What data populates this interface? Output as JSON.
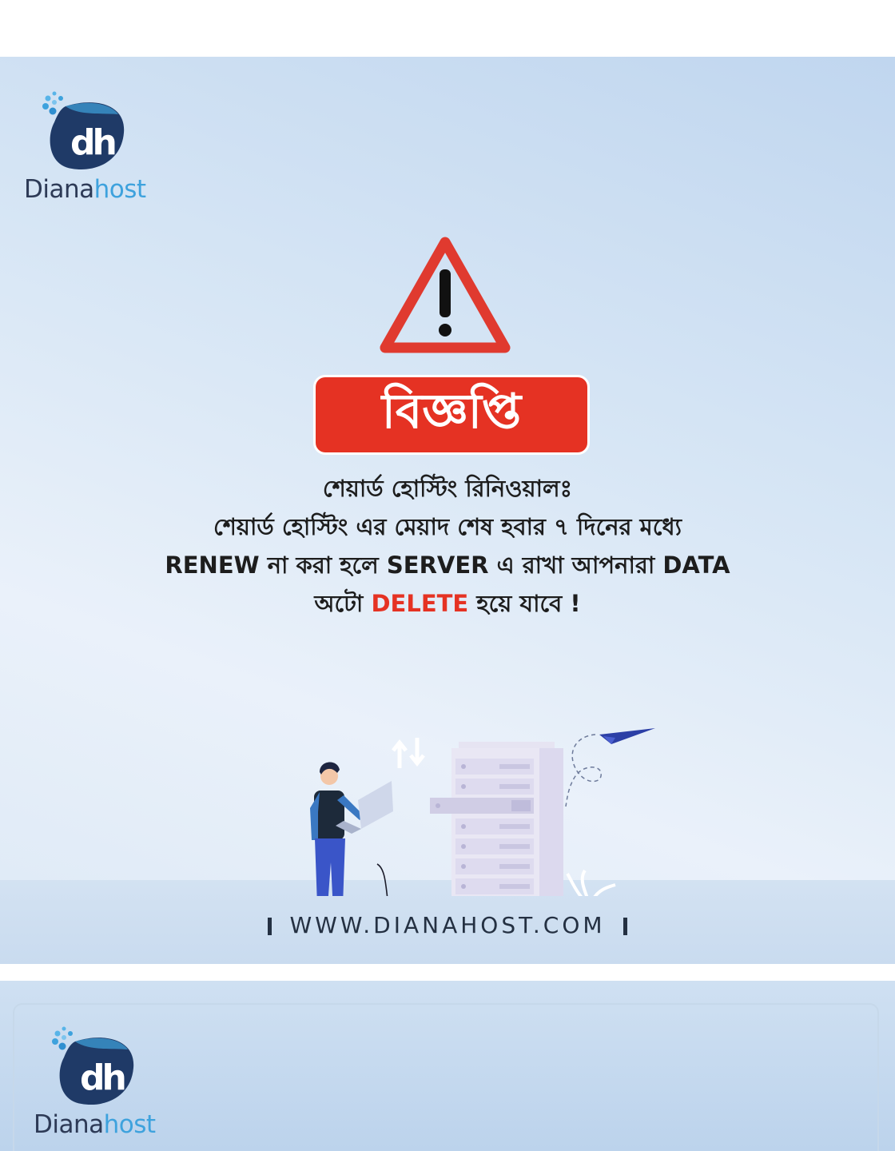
{
  "brand": {
    "name_part1": "Diana",
    "name_part2": "host",
    "logo_glyph": "dh",
    "colors": {
      "dark": "#2d3a56",
      "accent": "#3ea2dd",
      "alert_red": "#e53223"
    }
  },
  "notice": {
    "badge": "বিজ্ঞপ্তি",
    "heading": "শেয়ার্ড হোস্টিং রিনিওয়ালঃ",
    "line1": "শেয়ার্ড হোস্টিং এর মেয়াদ শেষ হবার ৭ দিনের মধ্যে",
    "line2": "RENEW না করা হলে SERVER এ রাখা আপনারা DATA",
    "line3_before": "অটো",
    "line3_highlight": "DELETE",
    "line3_after": "হয়ে যাবে !"
  },
  "website": "WWW.DIANAHOST.COM",
  "icons": [
    "warning-triangle-icon",
    "logo-icon",
    "paper-plane-icon",
    "server-rack-icon",
    "laptop-icon",
    "plant-icon",
    "upload-download-arrows-icon"
  ]
}
